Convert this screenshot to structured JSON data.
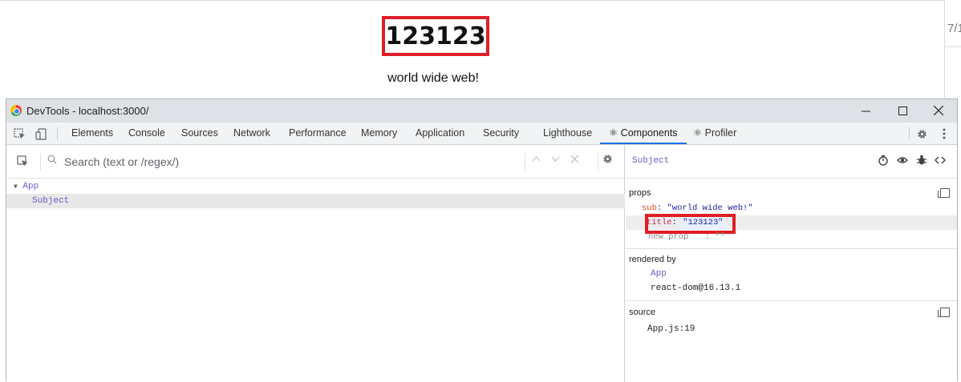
{
  "page": {
    "heading": "123123",
    "subtitle": "world wide web!",
    "side_fragment": "7/1"
  },
  "devtools": {
    "window_title": "DevTools - localhost:3000/",
    "tabs": [
      {
        "label": "Elements"
      },
      {
        "label": "Console"
      },
      {
        "label": "Sources"
      },
      {
        "label": "Network"
      },
      {
        "label": "Performance"
      },
      {
        "label": "Memory"
      },
      {
        "label": "Application"
      },
      {
        "label": "Security"
      },
      {
        "label": "Lighthouse"
      },
      {
        "label": "⚛ Components"
      },
      {
        "label": "⚛ Profiler"
      }
    ],
    "active_tab": "⚛ Components",
    "search_placeholder": "Search (text or /regex/)",
    "tree": [
      {
        "label": "App",
        "expanded": true
      },
      {
        "label": "Subject",
        "selected": true
      }
    ],
    "inspector": {
      "component": "Subject",
      "props_title": "props",
      "props": [
        {
          "key": "sub",
          "sep": ":",
          "value": "\"world wide web!\""
        },
        {
          "key": "title",
          "sep": ":",
          "value": "\"123123\""
        },
        {
          "key": "new prop",
          "sep": ":",
          "value": "\"\""
        }
      ],
      "rendered_by_title": "rendered by",
      "rendered_by": [
        "App",
        "react-dom@16.13.1"
      ],
      "source_title": "source",
      "source": "App.js:19"
    },
    "colors": {
      "highlight": "#e01e26",
      "accent": "#1a73e8",
      "component_name": "#6a5acd"
    }
  }
}
